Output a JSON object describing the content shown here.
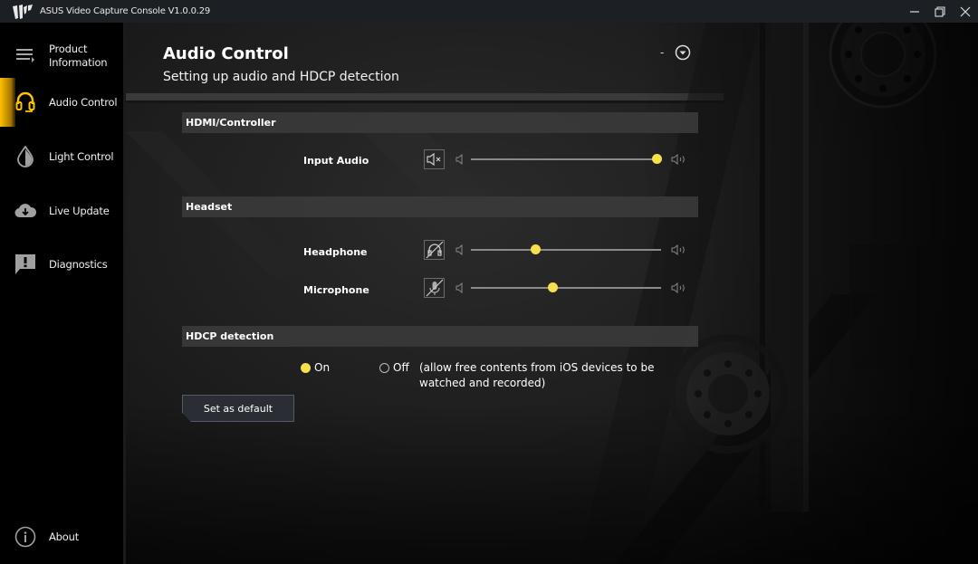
{
  "window": {
    "title": "ASUS Video Capture Console V1.0.0.29",
    "controls": [
      "minimize-icon",
      "restore-icon",
      "close-icon"
    ]
  },
  "sidebar": {
    "items": [
      {
        "label": "Product\nInformation",
        "line1": "Product",
        "line2": "Information",
        "icon": "menu-list-icon",
        "active": false
      },
      {
        "label": "Audio Control",
        "icon": "headset-icon",
        "active": true
      },
      {
        "label": "Light Control",
        "icon": "droplet-icon",
        "active": false
      },
      {
        "label": "Live Update",
        "icon": "cloud-download-icon",
        "active": false
      },
      {
        "label": "Diagnostics",
        "icon": "alert-message-icon",
        "active": false
      }
    ],
    "footer": {
      "label": "About",
      "icon": "info-icon"
    }
  },
  "main": {
    "title": "Audio Control",
    "subtitle": "Setting up audio and HDCP detection",
    "collapse_label": "-",
    "sections": {
      "hdmi": {
        "title": "HDMI/Controller",
        "rows": [
          {
            "label": "Input Audio",
            "mute_icon": "speaker-muted-icon",
            "volume_percent": 98
          }
        ]
      },
      "headset": {
        "title": "Headset",
        "rows": [
          {
            "label": "Headphone",
            "mute_icon": "headphone-muted-icon",
            "volume_percent": 34
          },
          {
            "label": "Microphone",
            "mute_icon": "microphone-muted-icon",
            "volume_percent": 43
          }
        ]
      },
      "hdcp": {
        "title": "HDCP detection",
        "options": [
          {
            "label": "On",
            "selected": true
          },
          {
            "label": "Off",
            "selected": false
          }
        ],
        "note": "(allow free contents from iOS devices to be watched and recorded)"
      }
    },
    "default_button": "Set as default"
  },
  "colors": {
    "accent": "#f7e04b",
    "active_tab": "#ffbf00",
    "section_bar": "#3a3a3a",
    "titlebar": "#1c1f24"
  }
}
